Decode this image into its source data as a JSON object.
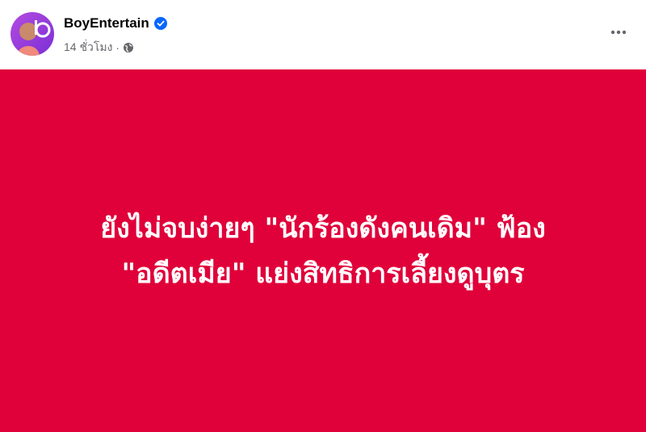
{
  "post": {
    "author": "BoyEntertain",
    "time": "14 ชั่วโมง",
    "separator": "·",
    "headline_line1": "ยังไม่จบง่ายๆ \"นักร้องดังคนเดิม\" ฟ้อง",
    "headline_line2": "\"อดีตเมีย\" แย่งสิทธิการเลี้ยงดูบุตร",
    "banner_color": "#e0003a",
    "verified_color": "#0866ff"
  },
  "icons": {
    "verified": "verified-badge-icon",
    "privacy": "globe-icon",
    "menu": "more-horizontal-icon"
  }
}
